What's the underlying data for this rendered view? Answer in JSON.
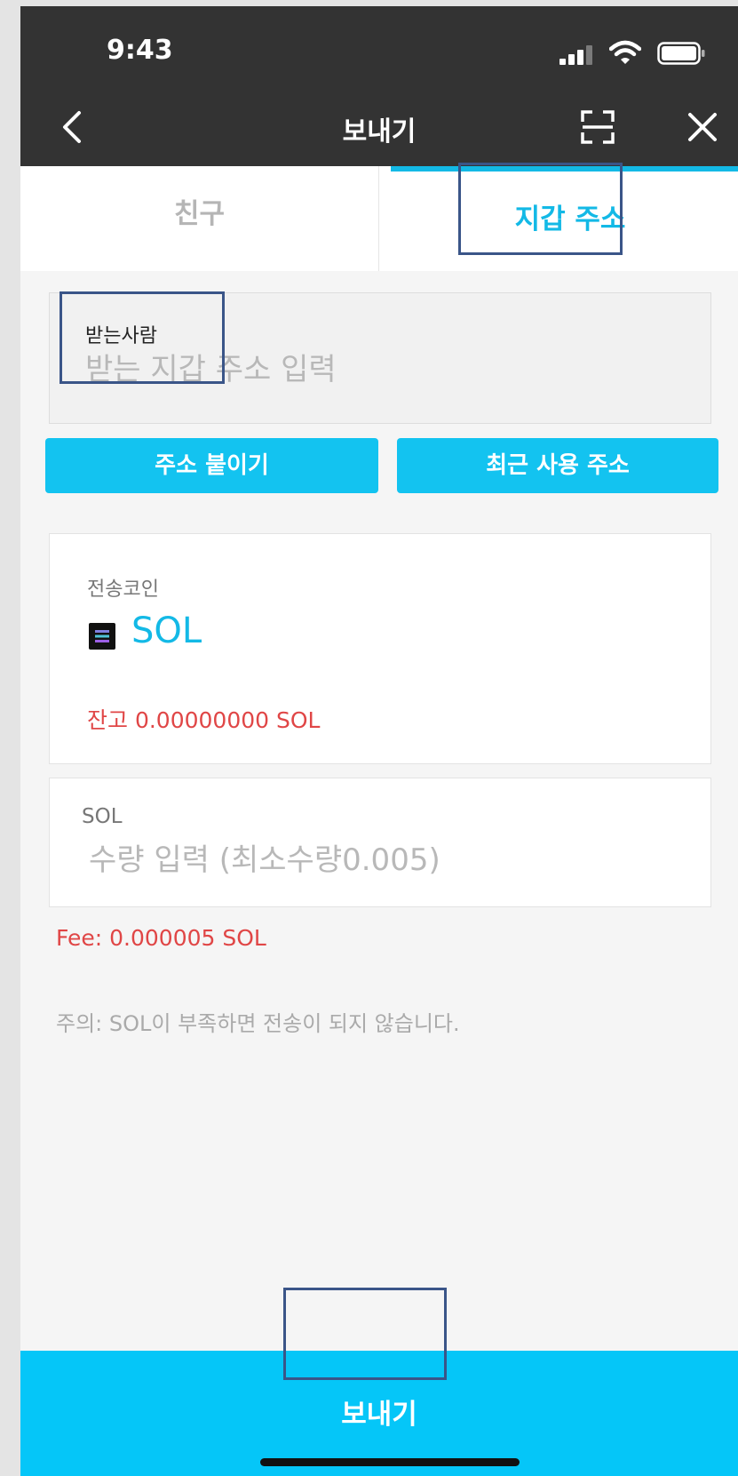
{
  "status": {
    "time": "9:43"
  },
  "nav": {
    "title": "보내기",
    "back_icon": "chevron-left-icon",
    "scan_icon": "qr-scan-icon",
    "close_icon": "close-icon"
  },
  "tabs": [
    {
      "label": "친구",
      "active": false
    },
    {
      "label": "지갑 주소",
      "active": true
    }
  ],
  "recipient": {
    "label": "받는사람",
    "value": "",
    "placeholder": "받는 지갑 주소 입력"
  },
  "buttons": {
    "paste": "주소 붙이기",
    "recent": "최근 사용 주소"
  },
  "coin": {
    "label": "전송코인",
    "name": "SOL",
    "balance": "잔고 0.00000000 SOL"
  },
  "amount": {
    "label": "SOL",
    "value": "",
    "placeholder": "수량 입력 (최소수량0.005)"
  },
  "fee": "Fee: 0.000005 SOL",
  "notice": "주의: SOL이 부족하면 전송이 되지 않습니다.",
  "send_button": "보내기",
  "colors": {
    "accent": "#13b9e6",
    "button": "#13c3f0",
    "send_bar": "#05c6f8",
    "header": "#333333",
    "warning": "#e04646"
  }
}
